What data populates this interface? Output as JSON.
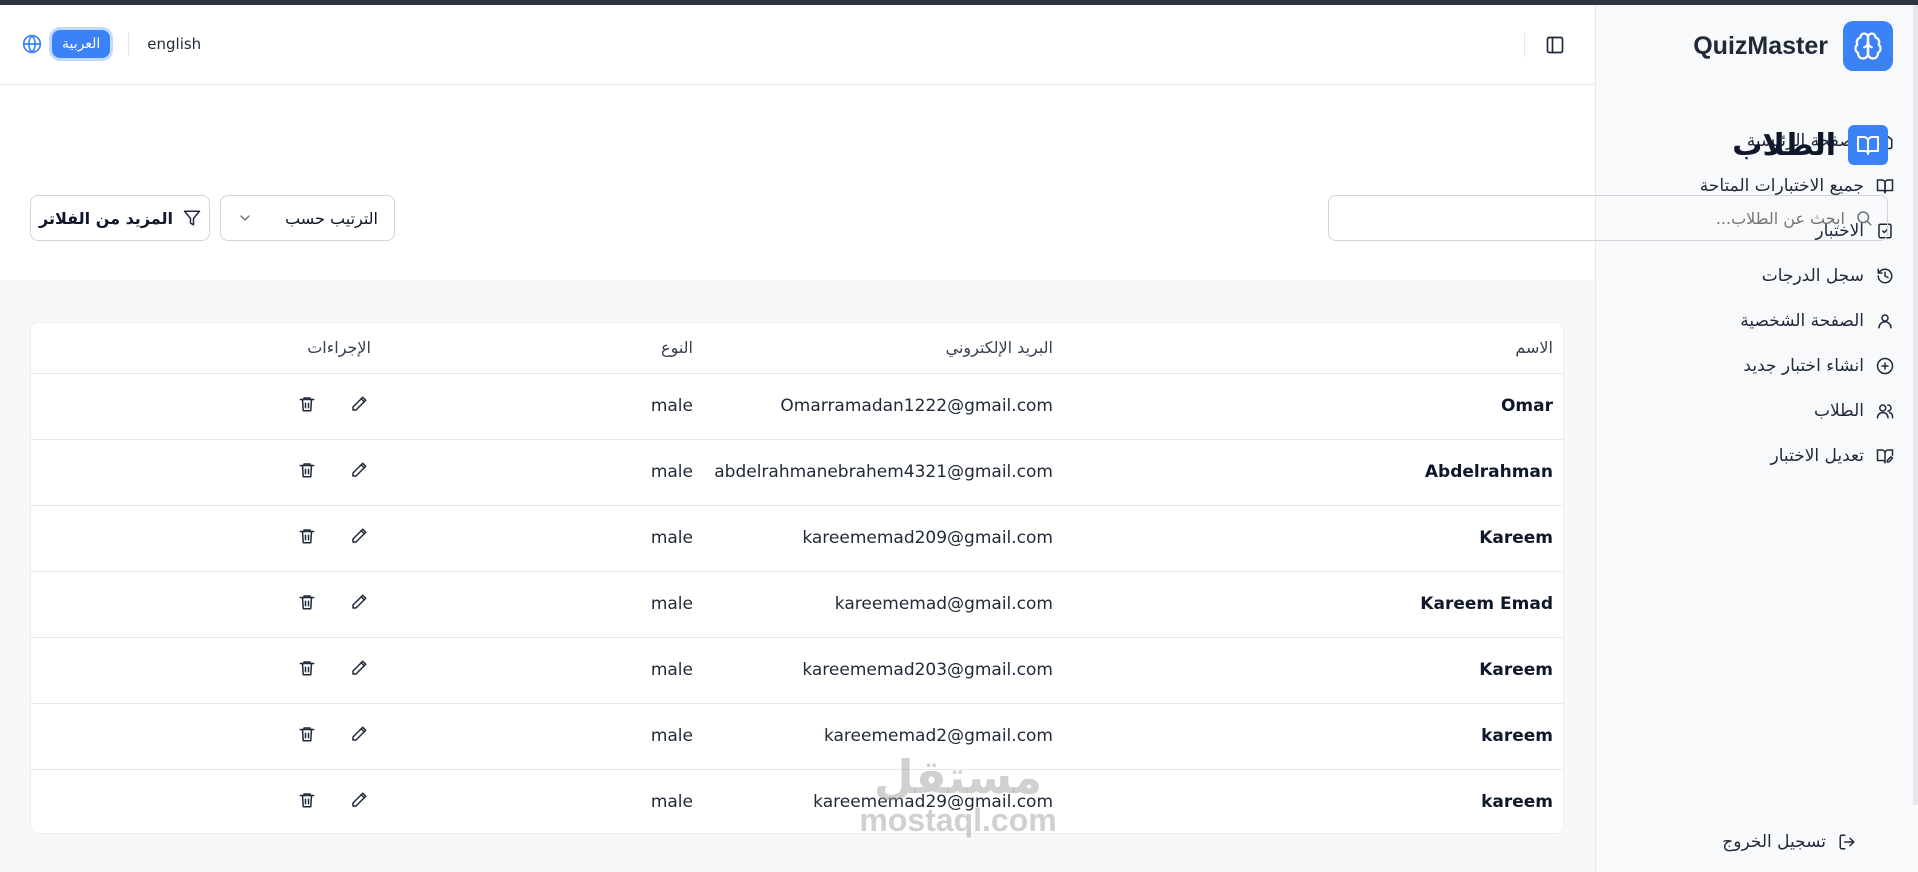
{
  "app": {
    "name": "QuizMaster"
  },
  "sidebar": {
    "items": [
      {
        "label": "الصفحة الرئيسية",
        "icon": "home-icon"
      },
      {
        "label": "جميع الاختبارات المتاحة",
        "icon": "book-open-icon"
      },
      {
        "label": "الاختبار",
        "icon": "clipboard-check-icon"
      },
      {
        "label": "سجل الدرجات",
        "icon": "history-icon"
      },
      {
        "label": "الصفحة الشخصية",
        "icon": "user-icon"
      },
      {
        "label": "انشاء اختبار جديد",
        "icon": "plus-circle-icon"
      },
      {
        "label": "الطلاب",
        "icon": "users-icon"
      },
      {
        "label": "تعديل الاختبار",
        "icon": "book-edit-icon"
      }
    ],
    "logout_label": "تسجيل الخروج"
  },
  "header": {
    "lang_ar": "العربية",
    "lang_en": "english"
  },
  "page": {
    "title": "الطلاب",
    "search_placeholder": "ابحث عن الطلاب...",
    "sort_label": "الترتيب حسب",
    "more_filters_label": "المزيد من الفلاتر"
  },
  "table": {
    "headers": {
      "name": "الاسم",
      "email": "البريد الإلكتروني",
      "gender": "النوع",
      "actions": "الإجراءات"
    },
    "rows": [
      {
        "name": "Omar",
        "email": "Omarramadan1222@gmail.com",
        "gender": "male"
      },
      {
        "name": "Abdelrahman",
        "email": "abdelrahmanebrahem4321@gmail.com",
        "gender": "male"
      },
      {
        "name": "Kareem",
        "email": "kareememad209@gmail.com",
        "gender": "male"
      },
      {
        "name": "Kareem Emad",
        "email": "kareememad@gmail.com",
        "gender": "male"
      },
      {
        "name": "Kareem",
        "email": "kareememad203@gmail.com",
        "gender": "male"
      },
      {
        "name": "kareem",
        "email": "kareememad2@gmail.com",
        "gender": "male"
      },
      {
        "name": "kareem",
        "email": "kareememad29@gmail.com",
        "gender": "male"
      }
    ]
  },
  "watermark": {
    "ar": "مستقل",
    "en": "mostaql.com"
  },
  "colors": {
    "accent": "#3b82f6",
    "sidebar_bg": "#f8f9fb",
    "content_bg": "#f7f8fa"
  }
}
